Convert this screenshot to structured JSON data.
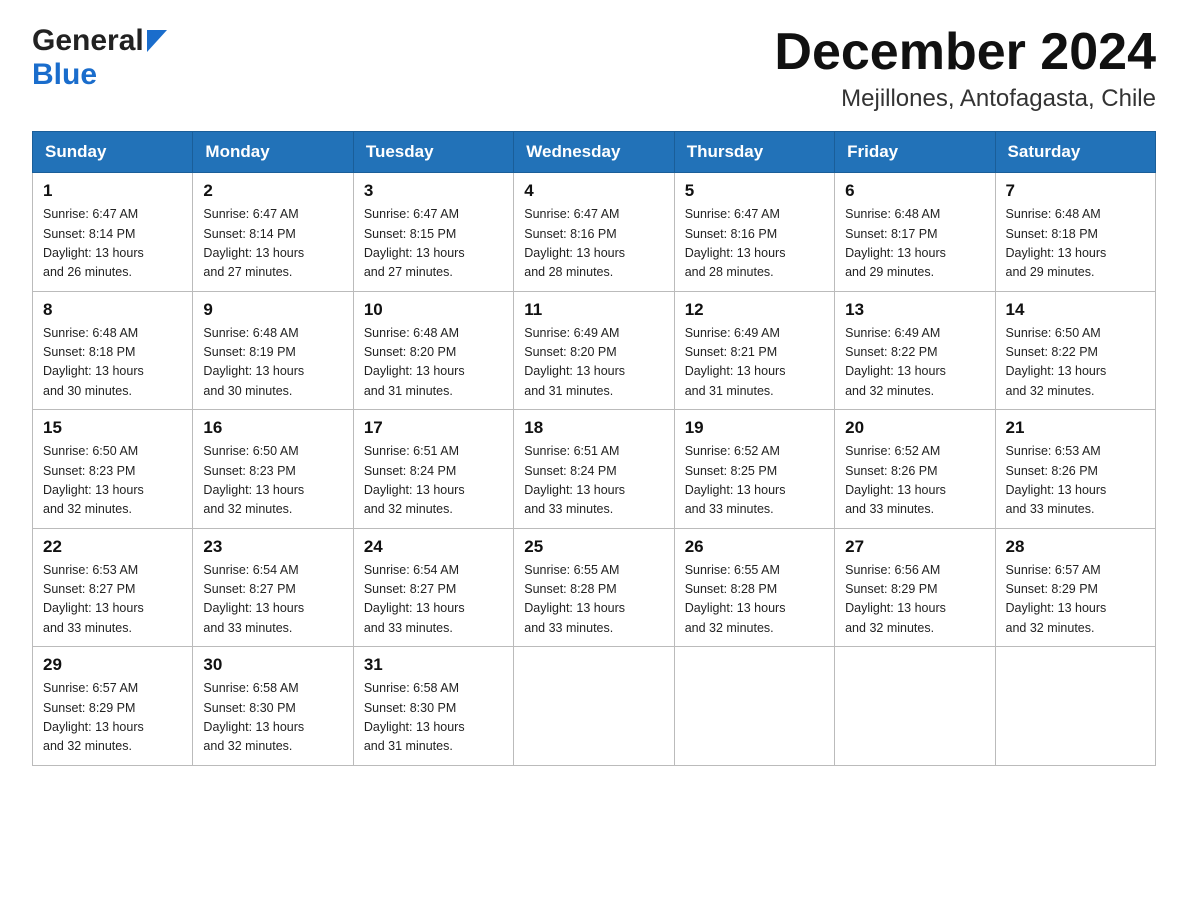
{
  "header": {
    "logo_general": "General",
    "logo_blue": "Blue",
    "title": "December 2024",
    "subtitle": "Mejillones, Antofagasta, Chile"
  },
  "days_of_week": [
    "Sunday",
    "Monday",
    "Tuesday",
    "Wednesday",
    "Thursday",
    "Friday",
    "Saturday"
  ],
  "weeks": [
    [
      {
        "num": "1",
        "sunrise": "6:47 AM",
        "sunset": "8:14 PM",
        "daylight": "13 hours and 26 minutes."
      },
      {
        "num": "2",
        "sunrise": "6:47 AM",
        "sunset": "8:14 PM",
        "daylight": "13 hours and 27 minutes."
      },
      {
        "num": "3",
        "sunrise": "6:47 AM",
        "sunset": "8:15 PM",
        "daylight": "13 hours and 27 minutes."
      },
      {
        "num": "4",
        "sunrise": "6:47 AM",
        "sunset": "8:16 PM",
        "daylight": "13 hours and 28 minutes."
      },
      {
        "num": "5",
        "sunrise": "6:47 AM",
        "sunset": "8:16 PM",
        "daylight": "13 hours and 28 minutes."
      },
      {
        "num": "6",
        "sunrise": "6:48 AM",
        "sunset": "8:17 PM",
        "daylight": "13 hours and 29 minutes."
      },
      {
        "num": "7",
        "sunrise": "6:48 AM",
        "sunset": "8:18 PM",
        "daylight": "13 hours and 29 minutes."
      }
    ],
    [
      {
        "num": "8",
        "sunrise": "6:48 AM",
        "sunset": "8:18 PM",
        "daylight": "13 hours and 30 minutes."
      },
      {
        "num": "9",
        "sunrise": "6:48 AM",
        "sunset": "8:19 PM",
        "daylight": "13 hours and 30 minutes."
      },
      {
        "num": "10",
        "sunrise": "6:48 AM",
        "sunset": "8:20 PM",
        "daylight": "13 hours and 31 minutes."
      },
      {
        "num": "11",
        "sunrise": "6:49 AM",
        "sunset": "8:20 PM",
        "daylight": "13 hours and 31 minutes."
      },
      {
        "num": "12",
        "sunrise": "6:49 AM",
        "sunset": "8:21 PM",
        "daylight": "13 hours and 31 minutes."
      },
      {
        "num": "13",
        "sunrise": "6:49 AM",
        "sunset": "8:22 PM",
        "daylight": "13 hours and 32 minutes."
      },
      {
        "num": "14",
        "sunrise": "6:50 AM",
        "sunset": "8:22 PM",
        "daylight": "13 hours and 32 minutes."
      }
    ],
    [
      {
        "num": "15",
        "sunrise": "6:50 AM",
        "sunset": "8:23 PM",
        "daylight": "13 hours and 32 minutes."
      },
      {
        "num": "16",
        "sunrise": "6:50 AM",
        "sunset": "8:23 PM",
        "daylight": "13 hours and 32 minutes."
      },
      {
        "num": "17",
        "sunrise": "6:51 AM",
        "sunset": "8:24 PM",
        "daylight": "13 hours and 32 minutes."
      },
      {
        "num": "18",
        "sunrise": "6:51 AM",
        "sunset": "8:24 PM",
        "daylight": "13 hours and 33 minutes."
      },
      {
        "num": "19",
        "sunrise": "6:52 AM",
        "sunset": "8:25 PM",
        "daylight": "13 hours and 33 minutes."
      },
      {
        "num": "20",
        "sunrise": "6:52 AM",
        "sunset": "8:26 PM",
        "daylight": "13 hours and 33 minutes."
      },
      {
        "num": "21",
        "sunrise": "6:53 AM",
        "sunset": "8:26 PM",
        "daylight": "13 hours and 33 minutes."
      }
    ],
    [
      {
        "num": "22",
        "sunrise": "6:53 AM",
        "sunset": "8:27 PM",
        "daylight": "13 hours and 33 minutes."
      },
      {
        "num": "23",
        "sunrise": "6:54 AM",
        "sunset": "8:27 PM",
        "daylight": "13 hours and 33 minutes."
      },
      {
        "num": "24",
        "sunrise": "6:54 AM",
        "sunset": "8:27 PM",
        "daylight": "13 hours and 33 minutes."
      },
      {
        "num": "25",
        "sunrise": "6:55 AM",
        "sunset": "8:28 PM",
        "daylight": "13 hours and 33 minutes."
      },
      {
        "num": "26",
        "sunrise": "6:55 AM",
        "sunset": "8:28 PM",
        "daylight": "13 hours and 32 minutes."
      },
      {
        "num": "27",
        "sunrise": "6:56 AM",
        "sunset": "8:29 PM",
        "daylight": "13 hours and 32 minutes."
      },
      {
        "num": "28",
        "sunrise": "6:57 AM",
        "sunset": "8:29 PM",
        "daylight": "13 hours and 32 minutes."
      }
    ],
    [
      {
        "num": "29",
        "sunrise": "6:57 AM",
        "sunset": "8:29 PM",
        "daylight": "13 hours and 32 minutes."
      },
      {
        "num": "30",
        "sunrise": "6:58 AM",
        "sunset": "8:30 PM",
        "daylight": "13 hours and 32 minutes."
      },
      {
        "num": "31",
        "sunrise": "6:58 AM",
        "sunset": "8:30 PM",
        "daylight": "13 hours and 31 minutes."
      },
      null,
      null,
      null,
      null
    ]
  ],
  "labels": {
    "sunrise": "Sunrise:",
    "sunset": "Sunset:",
    "daylight": "Daylight:"
  },
  "colors": {
    "header_bg": "#2272b8",
    "header_text": "#ffffff",
    "border": "#999999",
    "logo_blue": "#1a6dcc"
  }
}
